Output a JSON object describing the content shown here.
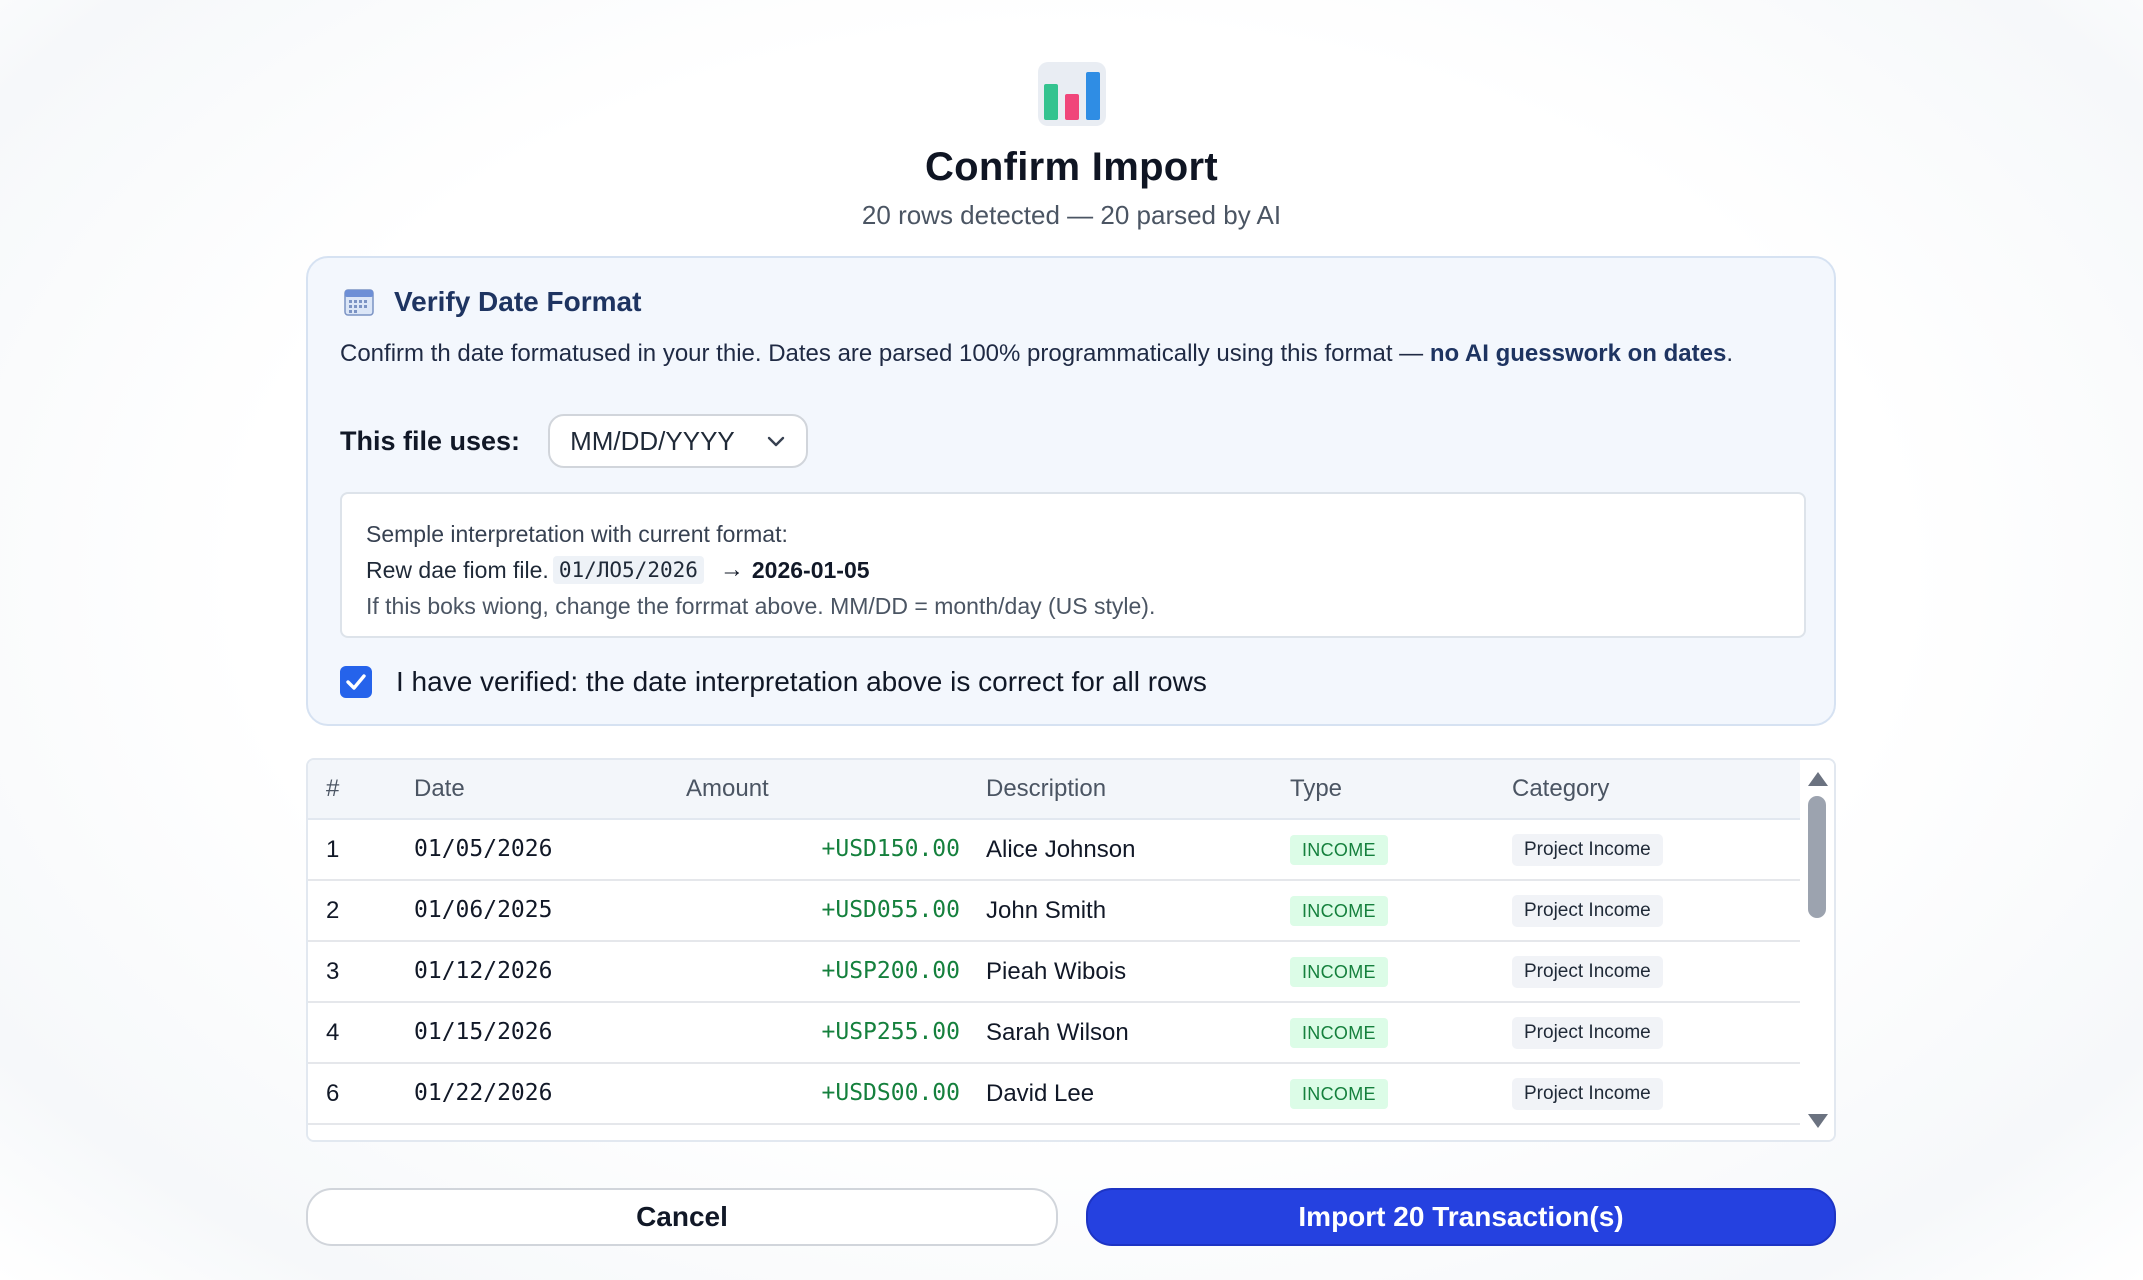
{
  "header": {
    "icon": "bar-chart-icon",
    "title": "Confirm Import",
    "subtitle": "20 rows detected — 20 parsed by AI"
  },
  "date_card": {
    "icon": "calendar-icon",
    "title": "Verify Date Format",
    "description": "Confirm th date formatused in your thie. Dates are parsed 100% programmatically using this format — ",
    "description_bold": "no AI guesswork on dates",
    "description_end": ".",
    "uses_label": "This file uses:",
    "format_value": "MM/DD/YYYY",
    "sample_intro": "Semple interpretation with current format:",
    "raw_label": "Rew dae fiom file.",
    "raw_value": "01/ЛО5/2026",
    "arrow": "→",
    "parsed_value": "2026-01-05",
    "hint": "If this boks wiong, change the forrmat above. MM/DD = month/day (US style).",
    "verified_checked": true,
    "verify_label": "I have verified: the date interpretation above is correct for all rows"
  },
  "table": {
    "columns": [
      "#",
      "Date",
      "Amount",
      "Description",
      "Type",
      "Category"
    ],
    "rows": [
      {
        "num": "1",
        "date": "01/05/2026",
        "amount": "+USD150.00",
        "description": "Alice Johnson",
        "type": "INCOME",
        "category": "Project Income"
      },
      {
        "num": "2",
        "date": "01/06/2025",
        "amount": "+USD055.00",
        "description": "John Smith",
        "type": "INCOME",
        "category": "Project Income"
      },
      {
        "num": "3",
        "date": "01/12/2026",
        "amount": "+USP200.00",
        "description": "Pieah Wibois",
        "type": "INCOME",
        "category": "Project Income"
      },
      {
        "num": "4",
        "date": "01/15/2026",
        "amount": "+USP255.00",
        "description": "Sarah Wilson",
        "type": "INCOME",
        "category": "Project Income"
      },
      {
        "num": "6",
        "date": "01/22/2026",
        "amount": "+USDS00.00",
        "description": "David Lee",
        "type": "INCOME",
        "category": "Project Income"
      }
    ]
  },
  "actions": {
    "cancel_label": "Cancel",
    "import_label": "Import 20 Transaction(s)"
  },
  "colors": {
    "accent": "#2541e0",
    "income_green": "#15803d",
    "card_bg": "#f3f7fd"
  }
}
